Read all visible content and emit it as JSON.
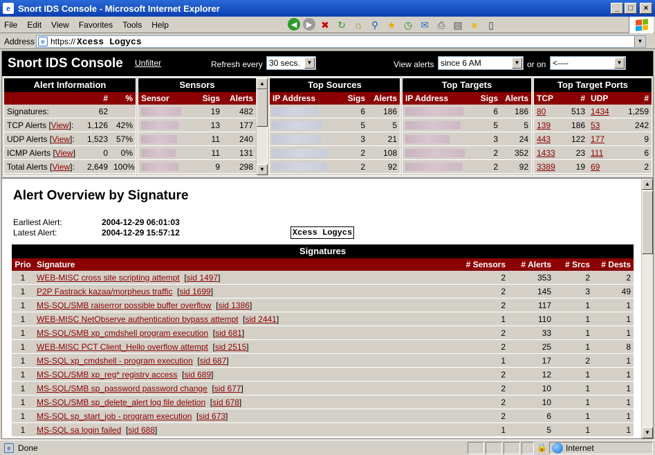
{
  "window": {
    "title": "Snort IDS Console - Microsoft Internet Explorer",
    "min_label": "_",
    "max_label": "□",
    "close_label": "×"
  },
  "menu": [
    "File",
    "Edit",
    "View",
    "Favorites",
    "Tools",
    "Help"
  ],
  "address": {
    "label": "Address",
    "url": "https://",
    "brand": "Xcess Logycs"
  },
  "header": {
    "title": "Snort IDS Console",
    "unfilter": "Unfilter",
    "refresh_label": "Refresh every",
    "refresh_value": "30 secs.",
    "view_label": "View alerts",
    "view_value": "since 6 AM",
    "or_label": "or on",
    "or_value": "<----"
  },
  "alert_info": {
    "title": "Alert Information",
    "headers": [
      "",
      "#",
      "%"
    ],
    "rows": [
      {
        "label": "Signatures:",
        "link": "",
        "count": "62",
        "pct": ""
      },
      {
        "label": "TCP Alerts [",
        "link": "View",
        "tail": "]:",
        "count": "1,126",
        "pct": "42%"
      },
      {
        "label": "UDP Alerts [",
        "link": "View",
        "tail": "]:",
        "count": "1,523",
        "pct": "57%"
      },
      {
        "label": "ICMP Alerts [",
        "link": "View",
        "tail": "]:",
        "count": "0",
        "pct": "0%"
      },
      {
        "label": "Total Alerts [",
        "link": "View",
        "tail": "]:",
        "count": "2,649",
        "pct": "100%"
      }
    ]
  },
  "sensors": {
    "title": "Sensors",
    "headers": [
      "Sensor",
      "Sigs",
      "Alerts"
    ],
    "rows": [
      {
        "sigs": "19",
        "alerts": "482"
      },
      {
        "sigs": "13",
        "alerts": "177"
      },
      {
        "sigs": "11",
        "alerts": "240"
      },
      {
        "sigs": "11",
        "alerts": "131"
      },
      {
        "sigs": "9",
        "alerts": "298"
      }
    ]
  },
  "top_sources": {
    "title": "Top Sources",
    "headers": [
      "IP Address",
      "Sigs",
      "Alerts"
    ],
    "rows": [
      {
        "sigs": "6",
        "alerts": "186"
      },
      {
        "sigs": "5",
        "alerts": "5"
      },
      {
        "sigs": "3",
        "alerts": "21"
      },
      {
        "sigs": "2",
        "alerts": "108"
      },
      {
        "sigs": "2",
        "alerts": "92"
      }
    ]
  },
  "top_targets": {
    "title": "Top Targets",
    "headers": [
      "IP Address",
      "Sigs",
      "Alerts"
    ],
    "rows": [
      {
        "sigs": "6",
        "alerts": "186"
      },
      {
        "sigs": "5",
        "alerts": "5"
      },
      {
        "sigs": "3",
        "alerts": "24"
      },
      {
        "sigs": "2",
        "alerts": "352"
      },
      {
        "sigs": "2",
        "alerts": "92"
      }
    ]
  },
  "top_ports": {
    "title": "Top Target Ports",
    "headers": [
      "TCP",
      "#",
      "UDP",
      "#"
    ],
    "rows": [
      {
        "tcp": "80",
        "tcp_n": "513",
        "udp": "1434",
        "udp_n": "1,259"
      },
      {
        "tcp": "139",
        "tcp_n": "186",
        "udp": "53",
        "udp_n": "242"
      },
      {
        "tcp": "443",
        "tcp_n": "122",
        "udp": "177",
        "udp_n": "9"
      },
      {
        "tcp": "1433",
        "tcp_n": "23",
        "udp": "111",
        "udp_n": "6"
      },
      {
        "tcp": "3389",
        "tcp_n": "19",
        "udp": "69",
        "udp_n": "2"
      }
    ]
  },
  "overview": {
    "title": "Alert Overview by Signature",
    "earliest_label": "Earliest Alert:",
    "earliest_value": "2004-12-29 06:01:03",
    "latest_label": "Latest Alert:",
    "latest_value": "2004-12-29 15:57:12",
    "watermark": "Xcess Logycs"
  },
  "signatures": {
    "title": "Signatures",
    "headers": {
      "prio": "Prio",
      "sig": "Signature",
      "sensors": "# Sensors",
      "alerts": "# Alerts",
      "srcs": "# Srcs",
      "dests": "# Dests"
    },
    "rows": [
      {
        "prio": "1",
        "name": "WEB-MISC cross site scripting attempt",
        "sid": "sid 1497",
        "sensors": "2",
        "alerts": "353",
        "srcs": "2",
        "dests": "2"
      },
      {
        "prio": "1",
        "name": "P2P Fastrack kazaa/morpheus traffic",
        "sid": "sid 1699",
        "sensors": "2",
        "alerts": "145",
        "srcs": "3",
        "dests": "49"
      },
      {
        "prio": "1",
        "name": "MS-SQL/SMB raiserror possible buffer overflow",
        "sid": "sid 1386",
        "sensors": "2",
        "alerts": "117",
        "srcs": "1",
        "dests": "1"
      },
      {
        "prio": "1",
        "name": "WEB-MISC NetObserve authentication bypass attempt",
        "sid": "sid 2441",
        "sensors": "1",
        "alerts": "110",
        "srcs": "1",
        "dests": "1"
      },
      {
        "prio": "1",
        "name": "MS-SQL/SMB xp_cmdshell program execution",
        "sid": "sid 681",
        "sensors": "2",
        "alerts": "33",
        "srcs": "1",
        "dests": "1"
      },
      {
        "prio": "1",
        "name": "WEB-MISC PCT Client_Hello overflow attempt",
        "sid": "sid 2515",
        "sensors": "2",
        "alerts": "25",
        "srcs": "1",
        "dests": "8"
      },
      {
        "prio": "1",
        "name": "MS-SQL xp_cmdshell - program execution",
        "sid": "sid 687",
        "sensors": "1",
        "alerts": "17",
        "srcs": "2",
        "dests": "1"
      },
      {
        "prio": "1",
        "name": "MS-SQL/SMB xp_reg* registry access",
        "sid": "sid 689",
        "sensors": "2",
        "alerts": "12",
        "srcs": "1",
        "dests": "1"
      },
      {
        "prio": "1",
        "name": "MS-SQL/SMB sp_password password change",
        "sid": "sid 677",
        "sensors": "2",
        "alerts": "10",
        "srcs": "1",
        "dests": "1"
      },
      {
        "prio": "1",
        "name": "MS-SQL/SMB sp_delete_alert log file deletion",
        "sid": "sid 678",
        "sensors": "2",
        "alerts": "10",
        "srcs": "1",
        "dests": "1"
      },
      {
        "prio": "1",
        "name": "MS-SQL sp_start_job - program execution",
        "sid": "sid 673",
        "sensors": "2",
        "alerts": "6",
        "srcs": "1",
        "dests": "1"
      },
      {
        "prio": "1",
        "name": "MS-SQL sa login failed",
        "sid": "sid 688",
        "sensors": "1",
        "alerts": "5",
        "srcs": "1",
        "dests": "1"
      }
    ]
  },
  "status": {
    "text": "Done",
    "zone": "Internet"
  }
}
